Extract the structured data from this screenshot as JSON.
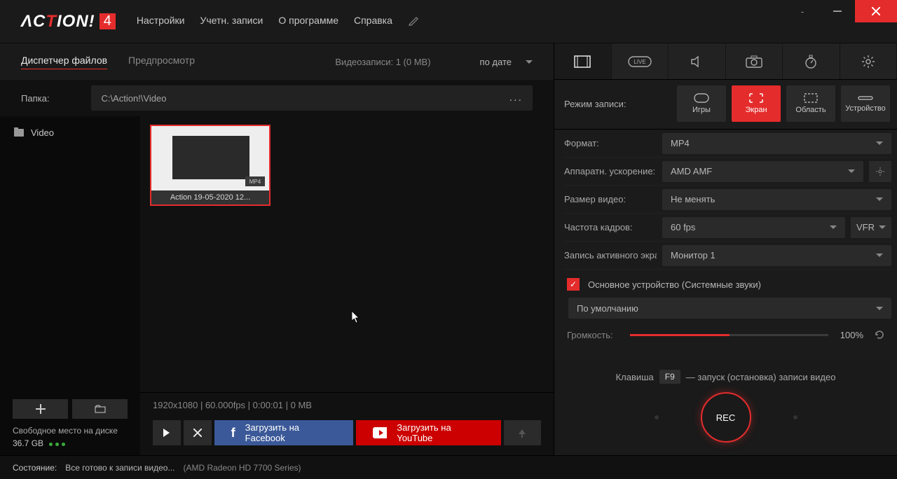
{
  "titlebar": {
    "menu": {
      "settings": "Настройки",
      "accounts": "Учетн. записи",
      "about": "О программе",
      "help": "Справка"
    }
  },
  "left": {
    "tabs": {
      "file_manager": "Диспетчер файлов",
      "preview": "Предпросмотр"
    },
    "recordings_info": "Видеозаписи: 1 (0 MB)",
    "sort_by": "по дате",
    "folder_label": "Папка:",
    "folder_path": "C:\\Action!\\Video",
    "tree": {
      "video": "Video"
    },
    "thumb": {
      "name": "Action 19-05-2020 12...",
      "badge": "MP4"
    },
    "file_info": "1920x1080 | 60.000fps | 0:00:01 | 0 MB",
    "buttons": {
      "facebook": "Загрузить на Facebook",
      "youtube": "Загрузить на YouTube"
    },
    "disk": {
      "label": "Свободное место на диске",
      "value": "36.7 GB"
    }
  },
  "right": {
    "mode_label": "Режим записи:",
    "modes": {
      "games": "Игры",
      "screen": "Экран",
      "region": "Область",
      "device": "Устройство"
    },
    "settings": {
      "format_label": "Формат:",
      "format_value": "MP4",
      "hwaccel_label": "Аппаратн. ускорение:",
      "hwaccel_value": "AMD AMF",
      "size_label": "Размер видео:",
      "size_value": "Не менять",
      "fps_label": "Частота кадров:",
      "fps_value": "60 fps",
      "vfr": "VFR",
      "activewin_label": "Запись активного экра",
      "activewin_value": "Монитор 1",
      "audio_check": "Основное устройство (Системные звуки)",
      "audio_device": "По умолчанию",
      "volume_label": "Громкость:",
      "volume_value": "100%"
    },
    "hotkey": {
      "prefix": "Клавиша",
      "key": "F9",
      "suffix": "— запуск (остановка) записи видео"
    },
    "rec": "REC"
  },
  "status": {
    "label": "Состояние:",
    "text": "Все готово к записи видео...",
    "gpu": "(AMD Radeon HD 7700 Series)"
  }
}
